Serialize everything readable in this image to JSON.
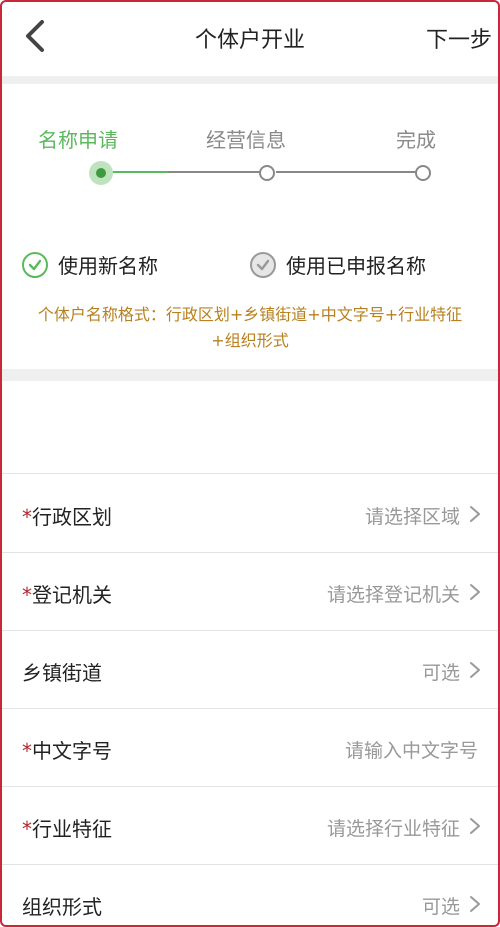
{
  "header": {
    "title": "个体户开业",
    "next_label": "下一步",
    "back_icon": "chevron-left-icon"
  },
  "steps": {
    "items": [
      {
        "label": "名称申请",
        "state": "active"
      },
      {
        "label": "经营信息",
        "state": "pending"
      },
      {
        "label": "完成",
        "state": "pending"
      }
    ],
    "active_color": "#5cb85c",
    "pending_color": "#8a8a8a"
  },
  "name_options": [
    {
      "label": "使用新名称",
      "selected": true,
      "icon": "check-circle-icon"
    },
    {
      "label": "使用已申报名称",
      "selected": false,
      "icon": "check-circle-icon"
    }
  ],
  "format_tip": {
    "line1": "个体户名称格式：行政区划+乡镇街道+中文字号+行业特征",
    "line2": "+组织形式",
    "color": "#b8801f"
  },
  "form": {
    "rows": [
      {
        "label": "行政区划",
        "required": "*",
        "value": "请选择区域"
      },
      {
        "label": "登记机关",
        "required": "*",
        "value": "请选择登记机关"
      },
      {
        "label": "乡镇街道",
        "required": "",
        "value": "可选"
      },
      {
        "label": "中文字号",
        "required": "*",
        "value": "请输入中文字号"
      },
      {
        "label": "行业特征",
        "required": "*",
        "value": "请选择行业特征"
      },
      {
        "label": "组织形式",
        "required": "",
        "value": "可选"
      }
    ],
    "required_color": "#b3262e"
  }
}
